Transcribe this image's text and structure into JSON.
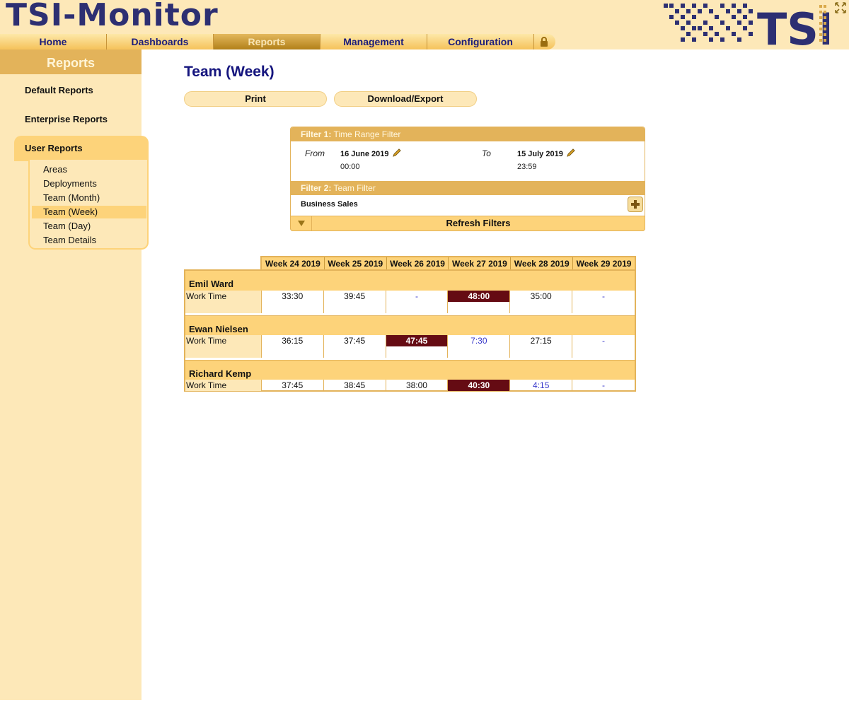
{
  "app": {
    "title": "TSI-Monitor",
    "logo_text": "TSI"
  },
  "nav": {
    "tabs": [
      {
        "label": "Home",
        "active": false
      },
      {
        "label": "Dashboards",
        "active": false
      },
      {
        "label": "Reports",
        "active": true
      },
      {
        "label": "Management",
        "active": false
      },
      {
        "label": "Configuration",
        "active": false
      }
    ],
    "lock_icon": "lock-icon"
  },
  "sidebar": {
    "title": "Reports",
    "categories": [
      "Default Reports",
      "Enterprise Reports",
      "User Reports"
    ],
    "sub_items": [
      {
        "label": "Areas",
        "selected": false
      },
      {
        "label": "Deployments",
        "selected": false
      },
      {
        "label": "Team (Month)",
        "selected": false
      },
      {
        "label": "Team (Week)",
        "selected": true
      },
      {
        "label": "Team (Day)",
        "selected": false
      },
      {
        "label": "Team Details",
        "selected": false
      }
    ]
  },
  "page": {
    "title": "Team (Week)",
    "print_label": "Print",
    "export_label": "Download/Export"
  },
  "filters": {
    "filter1": {
      "prefix": "Filter 1:",
      "name": "Time Range Filter"
    },
    "from_label": "From",
    "from_date": "16 June 2019",
    "from_time": "00:00",
    "to_label": "To",
    "to_date": "15 July 2019",
    "to_time": "23:59",
    "filter2": {
      "prefix": "Filter 2:",
      "name": "Team Filter"
    },
    "team_value": "Business Sales",
    "refresh_label": "Refresh Filters"
  },
  "report": {
    "weeks": [
      "Week 24 2019",
      "Week 25 2019",
      "Week 26 2019",
      "Week 27 2019",
      "Week 28 2019",
      "Week 29 2019"
    ],
    "row_label": "Work Time",
    "people": [
      {
        "name": "Emil Ward",
        "values": [
          "33:30",
          "39:45",
          "-",
          "48:00",
          "35:00",
          "-"
        ]
      },
      {
        "name": "Ewan Nielsen",
        "values": [
          "36:15",
          "37:45",
          "47:45",
          "7:30",
          "27:15",
          "-"
        ]
      },
      {
        "name": "Richard Kemp",
        "values": [
          "37:45",
          "38:45",
          "38:00",
          "40:30",
          "4:15",
          "-"
        ]
      }
    ]
  },
  "colors": {
    "brand_navy": "#2d2f72",
    "header_bg": "#fde8b8",
    "accent_gold": "#e3b35a",
    "highlight_bg": "#fdd37a",
    "over_time": "#650b13",
    "under_time": "#3a3acb"
  }
}
